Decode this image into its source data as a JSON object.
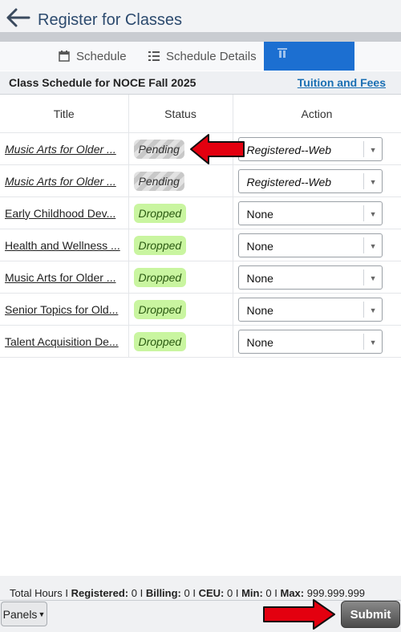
{
  "header": {
    "title": "Register for Classes"
  },
  "tabs": [
    {
      "label": "Schedule",
      "icon": "calendar-icon"
    },
    {
      "label": "Schedule Details",
      "icon": "list-icon"
    },
    {
      "label": "",
      "icon": "panel-icon",
      "active": true
    }
  ],
  "schedule": {
    "title": "Class Schedule for NOCE Fall 2025",
    "tuition_link": "Tuition and Fees",
    "columns": [
      "Title",
      "Status",
      "Action"
    ],
    "rows": [
      {
        "title": "Music Arts for Older ...",
        "status": "Pending",
        "action": "Registered--Web"
      },
      {
        "title": "Music Arts for Older ...",
        "status": "Pending",
        "action": "Registered--Web"
      },
      {
        "title": "Early Childhood Dev...",
        "status": "Dropped",
        "action": "None"
      },
      {
        "title": "Health and Wellness ...",
        "status": "Dropped",
        "action": "None"
      },
      {
        "title": "Music Arts for Older ...",
        "status": "Dropped",
        "action": "None"
      },
      {
        "title": "Senior Topics for Old...",
        "status": "Dropped",
        "action": "None"
      },
      {
        "title": "Talent Acquisition De...",
        "status": "Dropped",
        "action": "None"
      }
    ]
  },
  "footer": {
    "totals_prefix": "Total Hours",
    "registered_label": "Registered:",
    "registered_value": "0",
    "billing_label": "Billing:",
    "billing_value": "0",
    "ceu_label": "CEU:",
    "ceu_value": "0",
    "min_label": "Min:",
    "min_value": "0",
    "max_label": "Max:",
    "max_value": "999.999.999",
    "panels_label": "Panels",
    "submit_label": "Submit"
  },
  "colors": {
    "accent": "#1c6fd1",
    "dropped_bg": "#c9f5a0",
    "annotation": "#e3000f",
    "link": "#1a6fb3"
  }
}
